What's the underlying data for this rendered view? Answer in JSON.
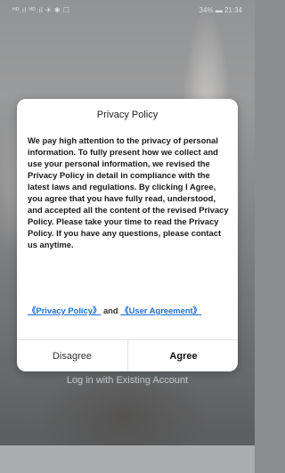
{
  "status_bar": {
    "left": "ᴴᴰ.ıl ᴴᴰ.ıl ✈ ✱ ☐",
    "right": "34% ▬ 21:34"
  },
  "background": {
    "login_link": "Log in with Existing Account"
  },
  "dialog": {
    "title": "Privacy Policy",
    "body": "We pay high attention to the privacy of personal information. To fully present how we collect and use your personal information, we revised the Privacy Policy in detail in compliance with the latest laws and regulations. By clicking I Agree, you agree that you have fully read, understood, and accepted all the content of the revised Privacy Policy. Please take your time to read the Privacy Policy. If you have any questions, please contact us anytime.",
    "privacy_link": "《Privacy Policy》",
    "and_text": " and ",
    "agreement_link": "《User Agreement》",
    "disagree_label": "Disagree",
    "agree_label": "Agree"
  },
  "colors": {
    "link": "#1f6fd1",
    "dialog_bg": "#ffffff"
  }
}
